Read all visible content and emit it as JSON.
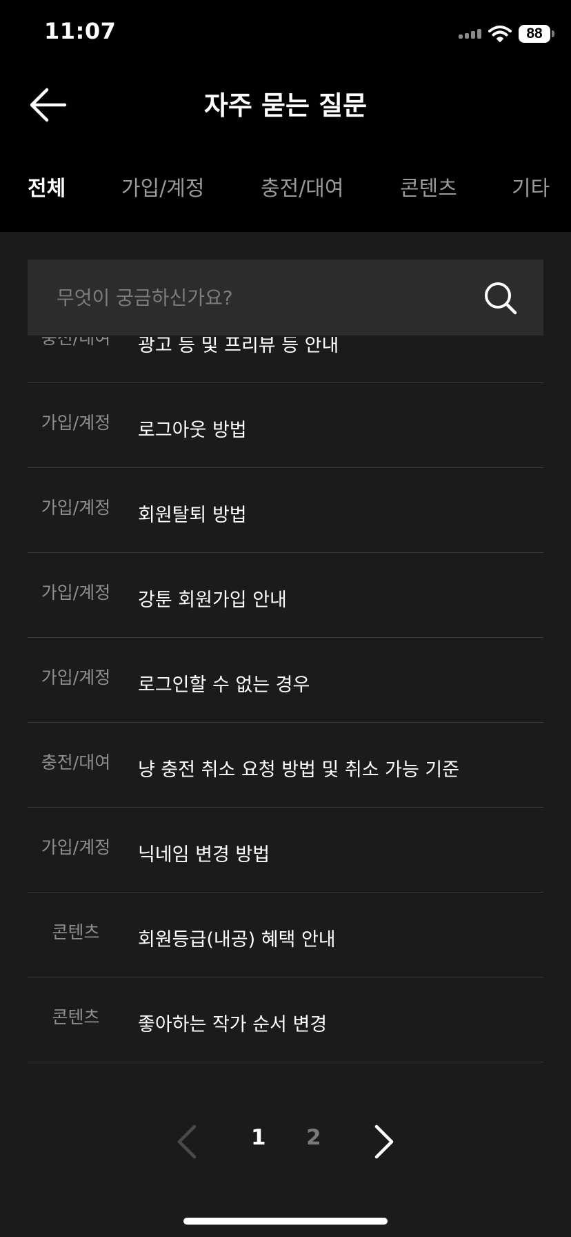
{
  "status_bar": {
    "time": "11:07",
    "battery": "88"
  },
  "header": {
    "title": "자주 묻는 질문"
  },
  "tabs": [
    {
      "label": "전체",
      "active": true
    },
    {
      "label": "가입/계정",
      "active": false
    },
    {
      "label": "충전/대여",
      "active": false
    },
    {
      "label": "콘텐츠",
      "active": false
    },
    {
      "label": "기타",
      "active": false
    }
  ],
  "search": {
    "placeholder": "무엇이 궁금하신가요?",
    "value": ""
  },
  "faq_items": [
    {
      "category": "충전/대여",
      "question": "광고 등 및 프리뷰 등 안내"
    },
    {
      "category": "가입/계정",
      "question": "로그아웃 방법"
    },
    {
      "category": "가입/계정",
      "question": "회원탈퇴 방법"
    },
    {
      "category": "가입/계정",
      "question": "강툰 회원가입 안내"
    },
    {
      "category": "가입/계정",
      "question": "로그인할 수 없는 경우"
    },
    {
      "category": "충전/대여",
      "question": "냥 충전 취소 요청 방법 및 취소 가능 기준"
    },
    {
      "category": "가입/계정",
      "question": "닉네임 변경 방법"
    },
    {
      "category": "콘텐츠",
      "question": "회원등급(내공) 혜택 안내"
    },
    {
      "category": "콘텐츠",
      "question": "좋아하는 작가 순서 변경"
    }
  ],
  "pagination": {
    "current_page": "1",
    "next_page": "2"
  },
  "colors": {
    "top_background": "#000000",
    "page_background": "#1b1b1b",
    "search_background": "#2c2c2c",
    "divider": "#3a3a3a",
    "muted_text": "#8e8e8e"
  }
}
